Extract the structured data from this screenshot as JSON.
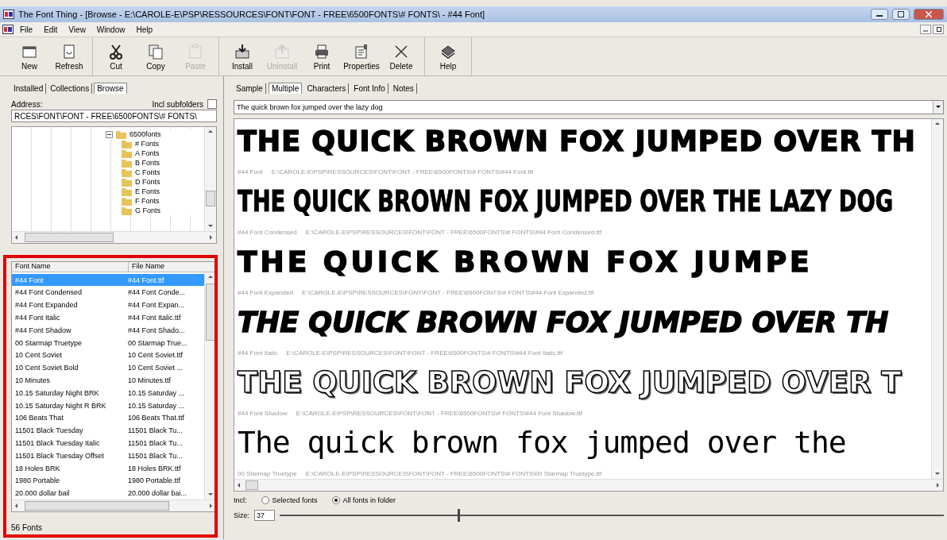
{
  "window": {
    "title": "The Font Thing - [Browse - E:\\CAROLE-E\\PSP\\RESSOURCES\\FONT\\FONT - FREE\\6500FONTS\\# FONTS\\ - #44 Font]"
  },
  "menu": [
    "File",
    "Edit",
    "View",
    "Window",
    "Help"
  ],
  "toolbar": [
    [
      {
        "label": "New",
        "disabled": false
      },
      {
        "label": "Refresh",
        "disabled": false
      }
    ],
    [
      {
        "label": "Cut",
        "disabled": false
      },
      {
        "label": "Copy",
        "disabled": false
      },
      {
        "label": "Paste",
        "disabled": true
      }
    ],
    [
      {
        "label": "Install",
        "disabled": false
      },
      {
        "label": "Uninstall",
        "disabled": true
      },
      {
        "label": "Print",
        "disabled": false
      },
      {
        "label": "Properties",
        "disabled": false
      },
      {
        "label": "Delete",
        "disabled": false
      }
    ],
    [
      {
        "label": "Help",
        "disabled": false
      }
    ]
  ],
  "left_tabs": [
    {
      "label": "Installed",
      "selected": false
    },
    {
      "label": "Collections",
      "selected": false
    },
    {
      "label": "Browse",
      "selected": true
    }
  ],
  "address": {
    "label": "Address:",
    "value": "RCES\\FONT\\FONT - FREE\\6500FONTS\\# FONTS\\"
  },
  "include_subfolders": {
    "label": "Incl subfolders",
    "checked": false
  },
  "folder_tree": [
    {
      "label": "6500fonts",
      "expanded": true,
      "children": [
        {
          "label": "# Fonts"
        },
        {
          "label": "A Fonts"
        },
        {
          "label": "B Fonts"
        },
        {
          "label": "C Fonts"
        },
        {
          "label": "D Fonts"
        },
        {
          "label": "E Fonts"
        },
        {
          "label": "F Fonts"
        },
        {
          "label": "G Fonts"
        }
      ]
    }
  ],
  "font_list": {
    "columns": [
      "Font Name",
      "File Name"
    ],
    "rows": [
      {
        "name": "#44 Font",
        "file": "#44 Font.ttf",
        "selected": true
      },
      {
        "name": "#44 Font Condensed",
        "file": "#44 Font Conde...",
        "selected": false
      },
      {
        "name": "#44 Font Expanded",
        "file": "#44 Font Expan...",
        "selected": false
      },
      {
        "name": "#44 Font Italic",
        "file": "#44 Font Italic.ttf",
        "selected": false
      },
      {
        "name": "#44 Font Shadow",
        "file": "#44 Font Shado...",
        "selected": false
      },
      {
        "name": "00 Starmap Truetype",
        "file": "00 Starmap True...",
        "selected": false
      },
      {
        "name": "10 Cent Soviet",
        "file": "10 Cent Soviet.ttf",
        "selected": false
      },
      {
        "name": "10 Cent Soviet Bold",
        "file": "10 Cent Soviet ...",
        "selected": false
      },
      {
        "name": "10 Minutes",
        "file": "10 Minutes.ttf",
        "selected": false
      },
      {
        "name": "10.15 Saturday Night BRK",
        "file": "10.15 Saturday ...",
        "selected": false
      },
      {
        "name": "10.15 Saturday Night R BRK",
        "file": "10.15 Saturday ...",
        "selected": false
      },
      {
        "name": "106 Beats That",
        "file": "106 Beats That.ttf",
        "selected": false
      },
      {
        "name": "11501 Black Tuesday",
        "file": "11501 Black Tu...",
        "selected": false
      },
      {
        "name": "11501 Black Tuesday Italic",
        "file": "11501 Black Tu...",
        "selected": false
      },
      {
        "name": "11501 Black Tuesday Offset",
        "file": "11501 Black Tu...",
        "selected": false
      },
      {
        "name": "18 Holes BRK",
        "file": "18 Holes BRK.ttf",
        "selected": false
      },
      {
        "name": "1980 Portable",
        "file": "1980 Portable.ttf",
        "selected": false
      },
      {
        "name": "20.000 dollar bail",
        "file": "20.000 dollar bai...",
        "selected": false
      }
    ]
  },
  "status": "56 Fonts",
  "right_tabs": [
    {
      "label": "Sample",
      "selected": false
    },
    {
      "label": "Multiple",
      "selected": true
    },
    {
      "label": "Characters",
      "selected": false
    },
    {
      "label": "Font Info",
      "selected": false
    },
    {
      "label": "Notes",
      "selected": false
    }
  ],
  "sample_text": "The quick brown fox jumped over the lazy dog",
  "samples": [
    {
      "kind": "heavy",
      "text": "THE QUICK BROWN FOX JUMPED OVER TH",
      "font": "#44 Font",
      "path": "E:\\CAROLE-E\\PSP\\RESSOURCES\\FONT\\FONT - FREE\\6500FONTS\\# FONTS\\#44 Font.ttf"
    },
    {
      "kind": "condensed",
      "text": "THE QUICK BROWN FOX JUMPED OVER THE LAZY DOG",
      "font": "#44 Font Condensed",
      "path": "E:\\CAROLE-E\\PSP\\RESSOURCES\\FONT\\FONT - FREE\\6500FONTS\\# FONTS\\#44 Font Condensed.ttf"
    },
    {
      "kind": "expanded",
      "text": "THE QUICK BROWN FOX JUMPE",
      "font": "#44 Font Expanded",
      "path": "E:\\CAROLE-E\\PSP\\RESSOURCES\\FONT\\FONT - FREE\\6500FONTS\\# FONTS\\#44 Font Expanded.ttf"
    },
    {
      "kind": "italic",
      "text": "THE QUICK BROWN FOX JUMPED OVER TH",
      "font": "#44 Font Italic",
      "path": "E:\\CAROLE-E\\PSP\\RESSOURCES\\FONT\\FONT - FREE\\6500FONTS\\# FONTS\\#44 Font Italic.ttf"
    },
    {
      "kind": "outline",
      "text": "THE QUICK BROWN FOX JUMPED OVER T",
      "font": "#44 Font Shadow",
      "path": "E:\\CAROLE-E\\PSP\\RESSOURCES\\FONT\\FONT - FREE\\6500FONTS\\# FONTS\\#44 Font Shadow.ttf"
    },
    {
      "kind": "pixel",
      "text": "The quick brown fox jumped over the",
      "font": "00 Starmap Truetype",
      "path": "E:\\CAROLE-E\\PSP\\RESSOURCES\\FONT\\FONT - FREE\\6500FONTS\\# FONTS\\00 Starmap Truetype.ttf"
    }
  ],
  "include": {
    "label": "Incl:",
    "options": [
      {
        "label": "Selected fonts",
        "selected": false
      },
      {
        "label": "All fonts in folder",
        "selected": true
      }
    ]
  },
  "size": {
    "label": "Size:",
    "value": "37",
    "level": 0.27
  }
}
